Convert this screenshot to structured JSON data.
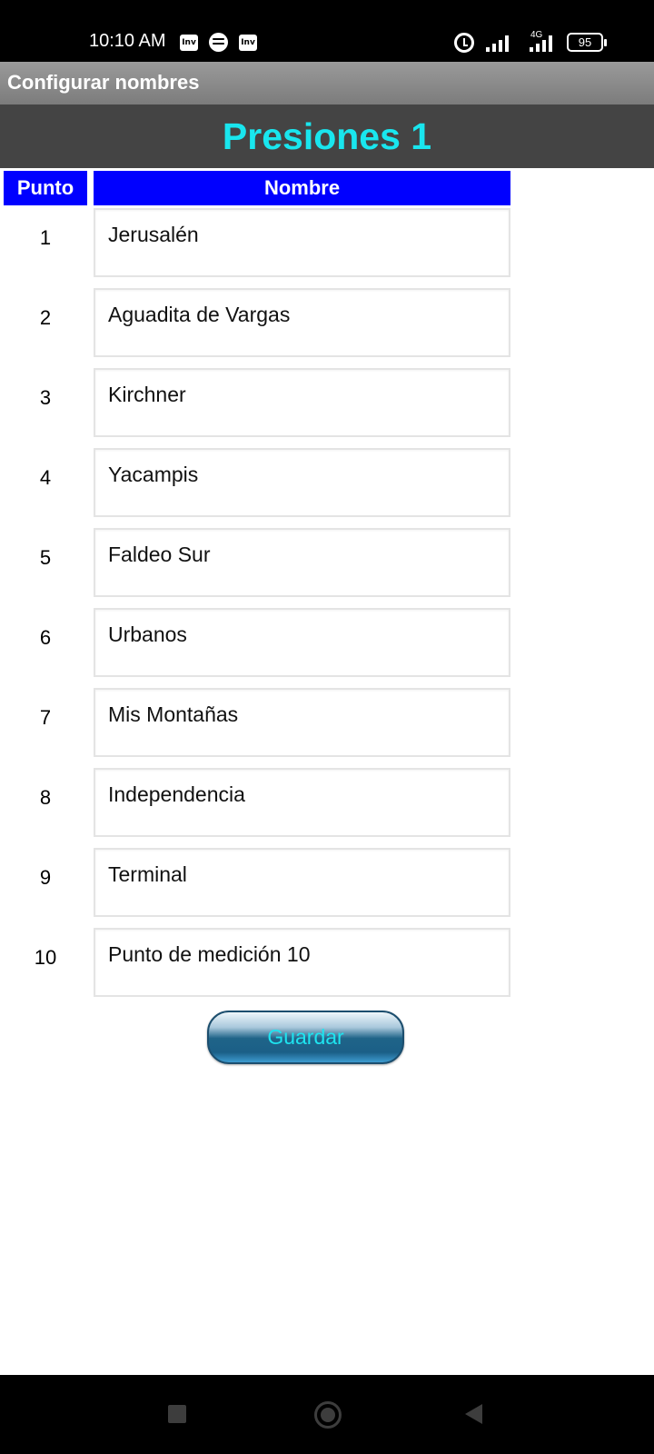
{
  "status_bar": {
    "time": "10:10 AM",
    "icons": [
      "app-icon",
      "spotify-icon",
      "app-icon",
      "alarm-icon",
      "signal-icon",
      "signal-icon"
    ],
    "app_badge": "Inv",
    "network": "4G",
    "battery": "95"
  },
  "title_bar": {
    "title": "Configurar nombres"
  },
  "header": {
    "title": "Presiones 1",
    "color": "#19e6ee"
  },
  "table": {
    "columns": [
      "Punto",
      "Nombre"
    ],
    "rows": [
      {
        "num": "1",
        "name": "Jerusalén"
      },
      {
        "num": "2",
        "name": "Aguadita de Vargas"
      },
      {
        "num": "3",
        "name": "Kirchner"
      },
      {
        "num": "4",
        "name": "Yacampis"
      },
      {
        "num": "5",
        "name": "Faldeo Sur"
      },
      {
        "num": "6",
        "name": "Urbanos"
      },
      {
        "num": "7",
        "name": "Mis Montañas"
      },
      {
        "num": "8",
        "name": "Independencia"
      },
      {
        "num": "9",
        "name": "Terminal"
      },
      {
        "num": "10",
        "name": "Punto de medición 10"
      }
    ]
  },
  "save_button": {
    "label": "Guardar"
  },
  "colors": {
    "column_header": "#0000ff",
    "header_bg": "#444444",
    "title_bar_bg": "#8a8a8a"
  },
  "nav_bar": {
    "icons": [
      "recent-apps-icon",
      "home-icon",
      "back-icon"
    ]
  }
}
